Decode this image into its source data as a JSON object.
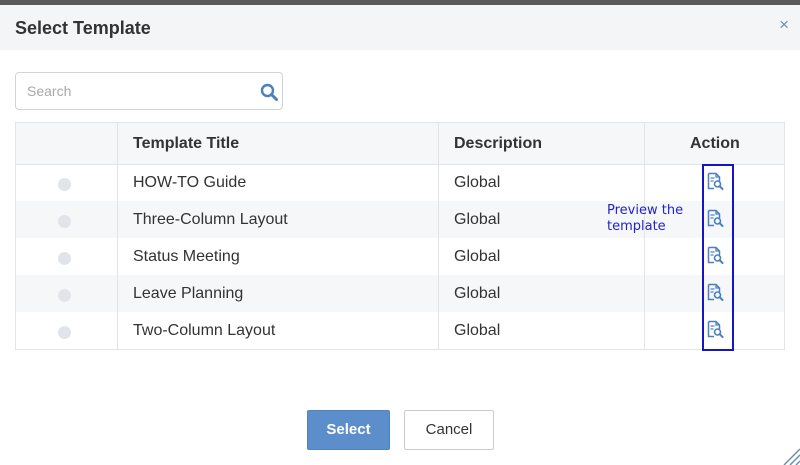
{
  "dialog": {
    "title": "Select Template",
    "close_glyph": "×"
  },
  "search": {
    "placeholder": "Search",
    "value": ""
  },
  "table": {
    "columns": [
      "",
      "Template Title",
      "Description",
      "Action"
    ],
    "rows": [
      {
        "title": "HOW-TO Guide",
        "description": "Global"
      },
      {
        "title": "Three-Column Layout",
        "description": "Global"
      },
      {
        "title": "Status Meeting",
        "description": "Global"
      },
      {
        "title": "Leave Planning",
        "description": "Global"
      },
      {
        "title": "Two-Column Layout",
        "description": "Global"
      }
    ]
  },
  "tooltip": {
    "text": "Preview the template"
  },
  "buttons": {
    "select_label": "Select",
    "cancel_label": "Cancel"
  },
  "colors": {
    "accent": "#5b8ecb",
    "icon": "#4a7fc1",
    "highlight": "#1515c8",
    "header_bg": "#f4f5f6"
  },
  "icons": {
    "search": "search-icon",
    "preview": "preview-document-icon",
    "close": "close-icon"
  }
}
